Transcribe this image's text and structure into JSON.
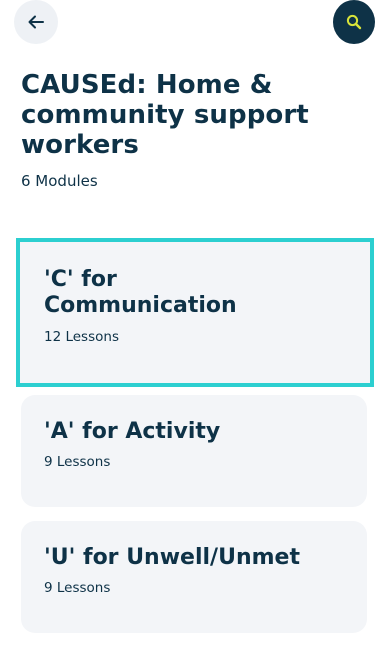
{
  "header": {
    "back_icon": "arrow-left-icon",
    "search_icon": "search-icon",
    "accent_color": "#d8e43a",
    "dark_color": "#0e3247"
  },
  "course": {
    "title": "CAUSEd: Home & community support workers",
    "module_count": "6 Modules"
  },
  "modules": [
    {
      "title": "'C' for Communication",
      "lessons": "12 Lessons",
      "selected": true
    },
    {
      "title": "'A' for Activity",
      "lessons": "9 Lessons",
      "selected": false
    },
    {
      "title": "'U' for Unwell/Unmet",
      "lessons": "9 Lessons",
      "selected": false
    }
  ],
  "selection_color": "#2ccfd0"
}
